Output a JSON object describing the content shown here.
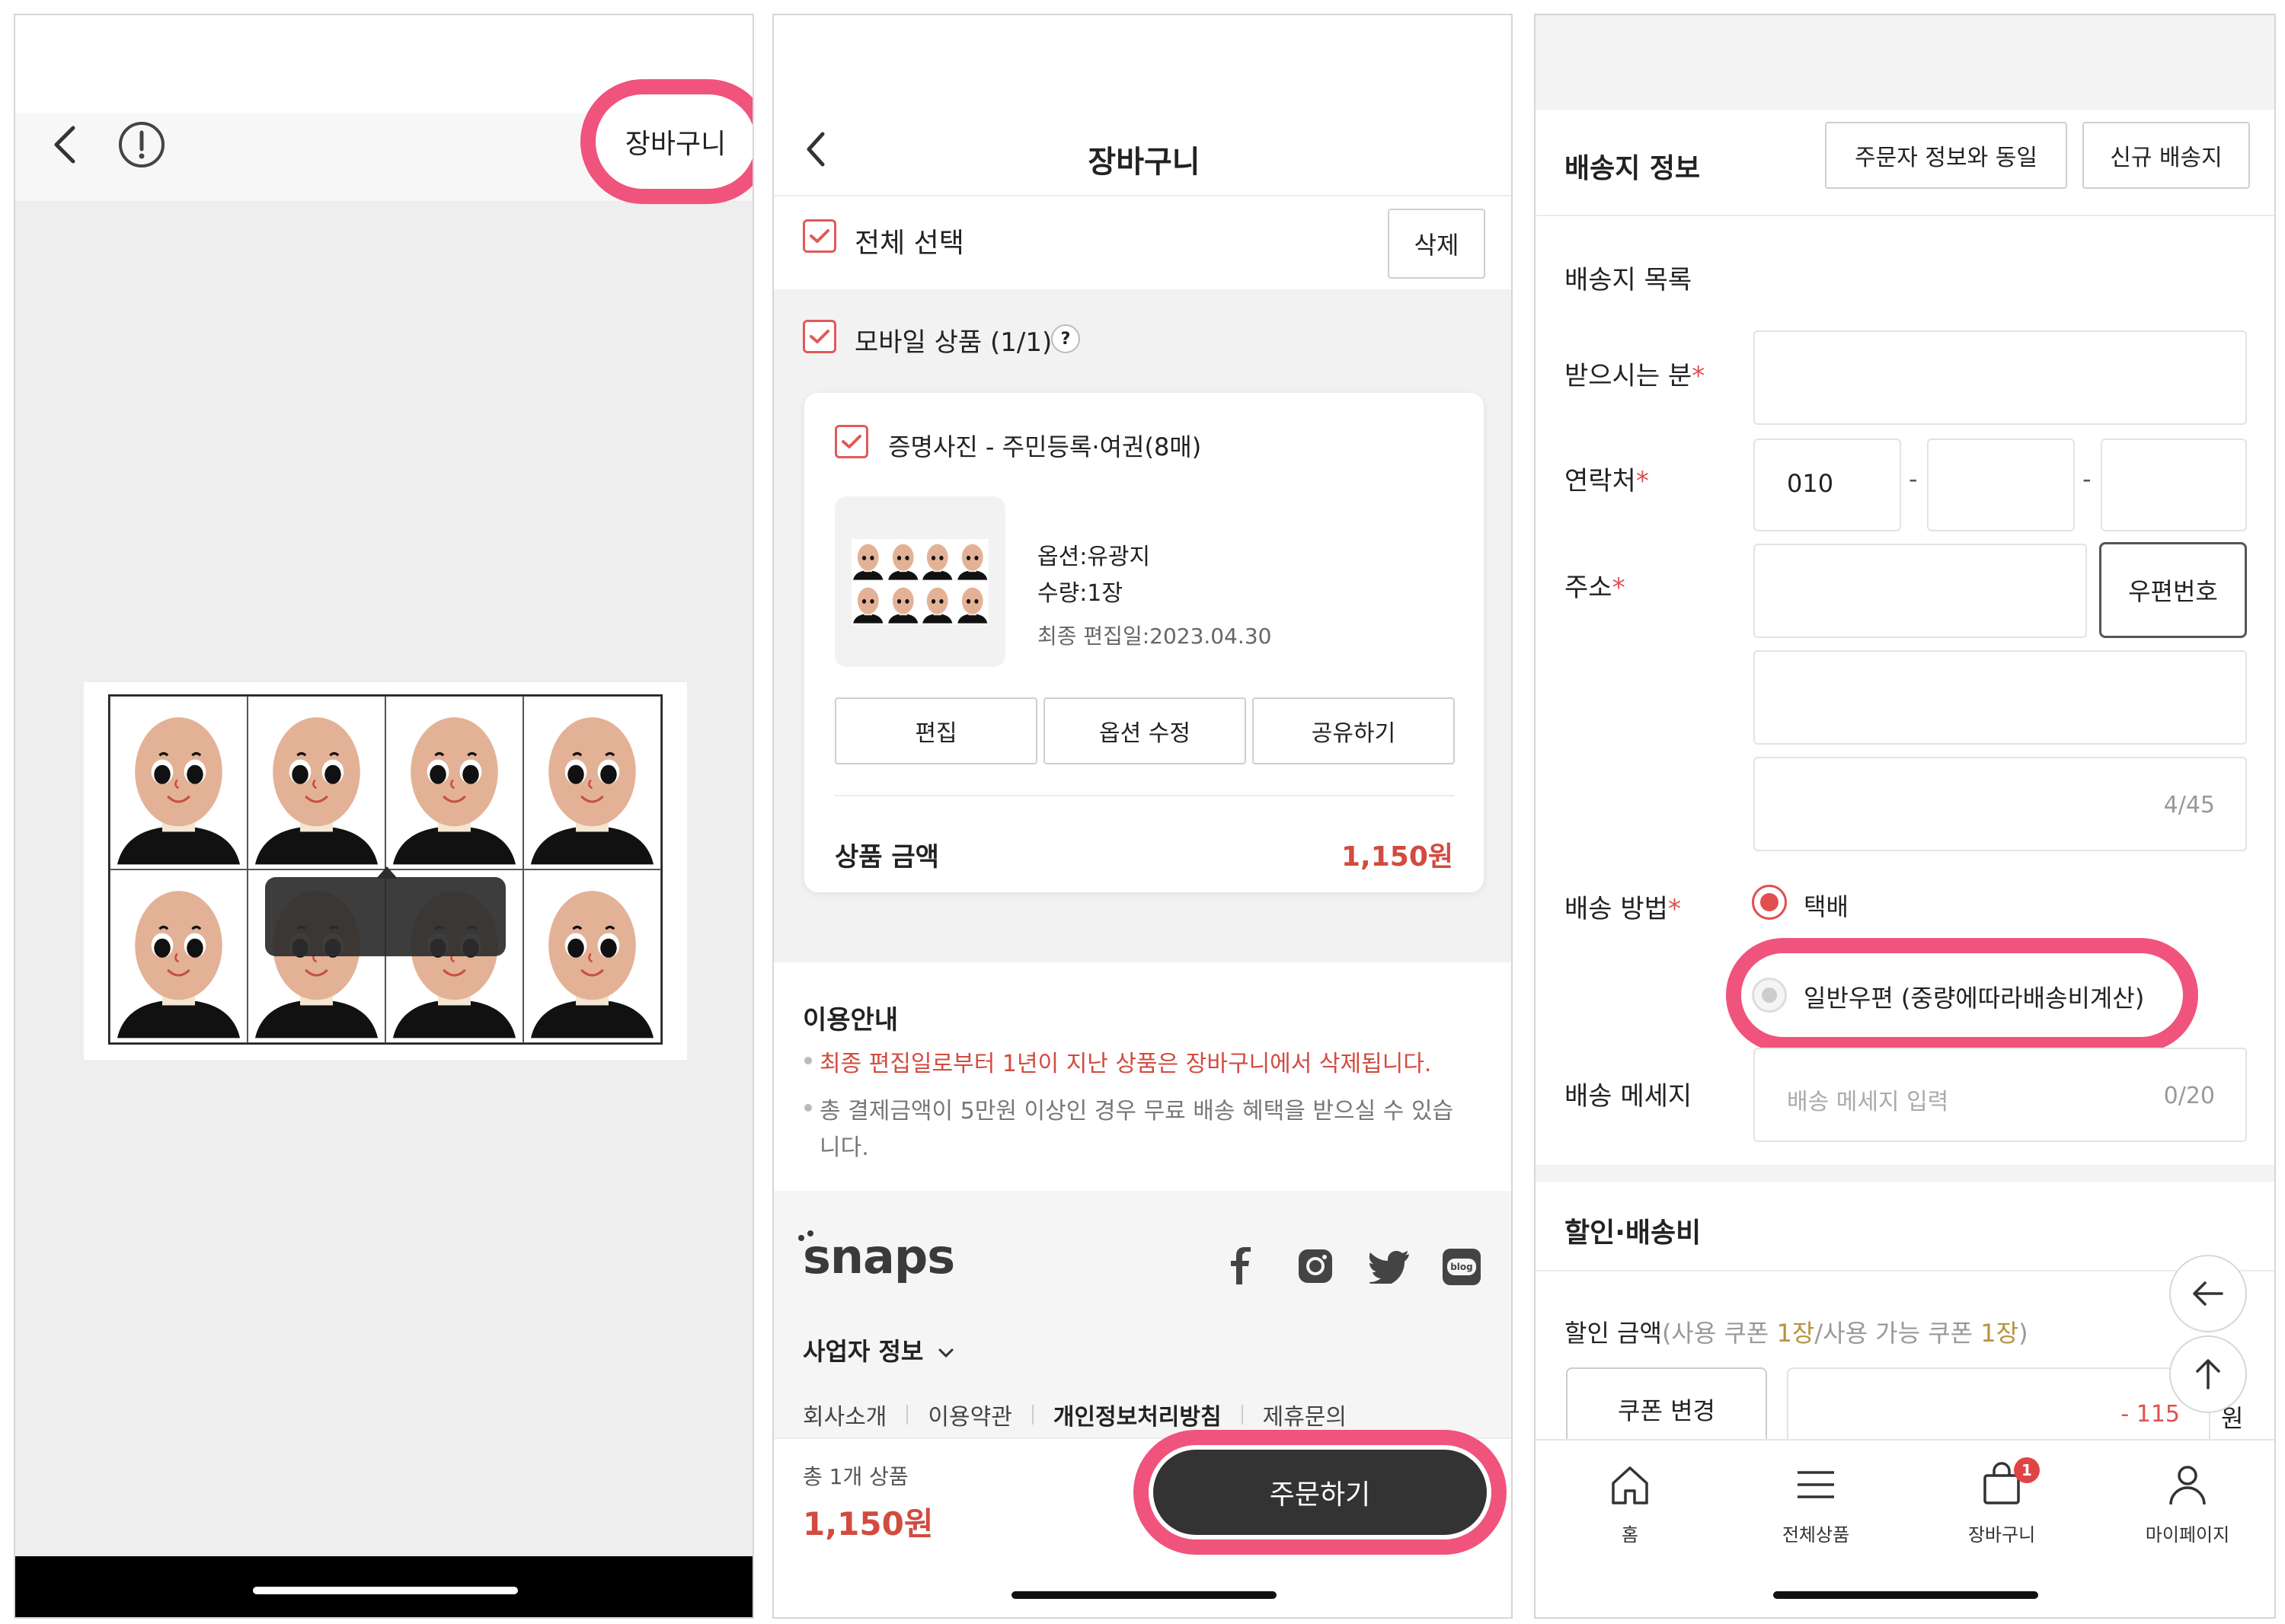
{
  "colors": {
    "accent": "#d24b3f",
    "highlight": "#f0537c",
    "dark_button": "#333333"
  },
  "screen1": {
    "back_icon": "chevron-left-icon",
    "info_icon": "exclamation-circle-icon",
    "cart_label": "장바구니"
  },
  "screen2": {
    "title": "장바구니",
    "select_all": "전체 선택",
    "delete": "삭제",
    "group_label": "모바일 상품 (1/1)",
    "help_glyph": "?",
    "item_name": "증명사진 - 주민등록·여권(8매)",
    "option": "옵션:유광지",
    "quantity": "수량:1장",
    "last_edit": "최종 편집일:2023.04.30",
    "btn_edit": "편집",
    "btn_option": "옵션 수정",
    "btn_share": "공유하기",
    "price_label": "상품 금액",
    "price": "1,150원",
    "guide_title": "이용안내",
    "guide_1": "최종 편집일로부터 1년이 지난 상품은 장바구니에서 삭제됩니다.",
    "guide_2a": "총 결제금액이 5만원 이상인 경우 무료 배송 혜택을 받으실 수 있습",
    "guide_2b": "니다.",
    "brand": "snaps",
    "biz_info": "사업자 정보",
    "links": [
      "회사소개",
      "이용약관",
      "개인정보처리방침",
      "제휴문의"
    ],
    "total_count": "총 1개 상품",
    "total_price": "1,150원",
    "order_button": "주문하기",
    "social_icons": [
      "facebook-icon",
      "instagram-icon",
      "twitter-icon",
      "blog-icon"
    ],
    "blog_glyph": "blog"
  },
  "screen3": {
    "section_title": "배송지 정보",
    "btn_same": "주문자 정보와 동일",
    "btn_new": "신규 배송지",
    "address_list": "배송지 목록",
    "recipient_label": "받으시는 분",
    "phone_label": "연락처",
    "phone_prefix": "010",
    "dash": "-",
    "address_label": "주소",
    "zipcode_button": "우편번호",
    "address_counter": "4/45",
    "shipping_method_label": "배송 방법",
    "method_courier": "택배",
    "method_post": "일반우편 (중량에따라배송비계산)",
    "message_label": "배송 메세지",
    "message_placeholder": "배송 메세지 입력",
    "message_counter": "0/20",
    "required_mark": "*",
    "discount_title": "할인·배송비",
    "discount_label": "할인 금액",
    "coupon_open": "(사용 쿠폰 ",
    "coupon_used": "1장",
    "coupon_mid": "/사용 가능 쿠폰 ",
    "coupon_available": "1장",
    "coupon_close": ")",
    "coupon_button": "쿠폰 변경",
    "discount_amount": "- 115",
    "won": "원",
    "tabs": [
      {
        "label": "홈",
        "icon": "home-icon"
      },
      {
        "label": "전체상품",
        "icon": "menu-icon"
      },
      {
        "label": "장바구니",
        "icon": "shopping-bag-icon",
        "badge": "1"
      },
      {
        "label": "마이페이지",
        "icon": "user-icon"
      }
    ]
  }
}
